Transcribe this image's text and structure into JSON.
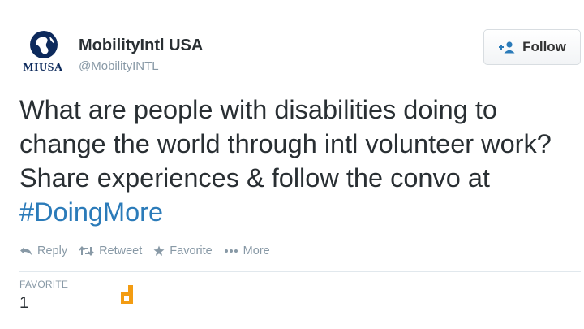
{
  "profile": {
    "avatar_text": "MIUSA",
    "name": "MobilityIntl USA",
    "handle": "@MobilityINTL"
  },
  "follow_button": {
    "label": "Follow",
    "icon": "add-user-icon"
  },
  "tweet": {
    "text": "What are people with disabilities doing to change the world through intl volunteer work? Share experiences & follow the convo at ",
    "hashtag": "#DoingMore"
  },
  "actions": [
    {
      "label": "Reply",
      "icon": "reply-icon"
    },
    {
      "label": "Retweet",
      "icon": "retweet-icon"
    },
    {
      "label": "Favorite",
      "icon": "star-icon"
    },
    {
      "label": "More",
      "icon": "more-dots-icon"
    }
  ],
  "stats": {
    "favorite_label": "FAVORITE",
    "favorite_count": "1"
  },
  "colors": {
    "link": "#2b7bb9",
    "muted": "#8899a6",
    "text": "#292f33",
    "brand_navy": "#0d2a5c",
    "fav_avatar_orange": "#f39c12"
  }
}
